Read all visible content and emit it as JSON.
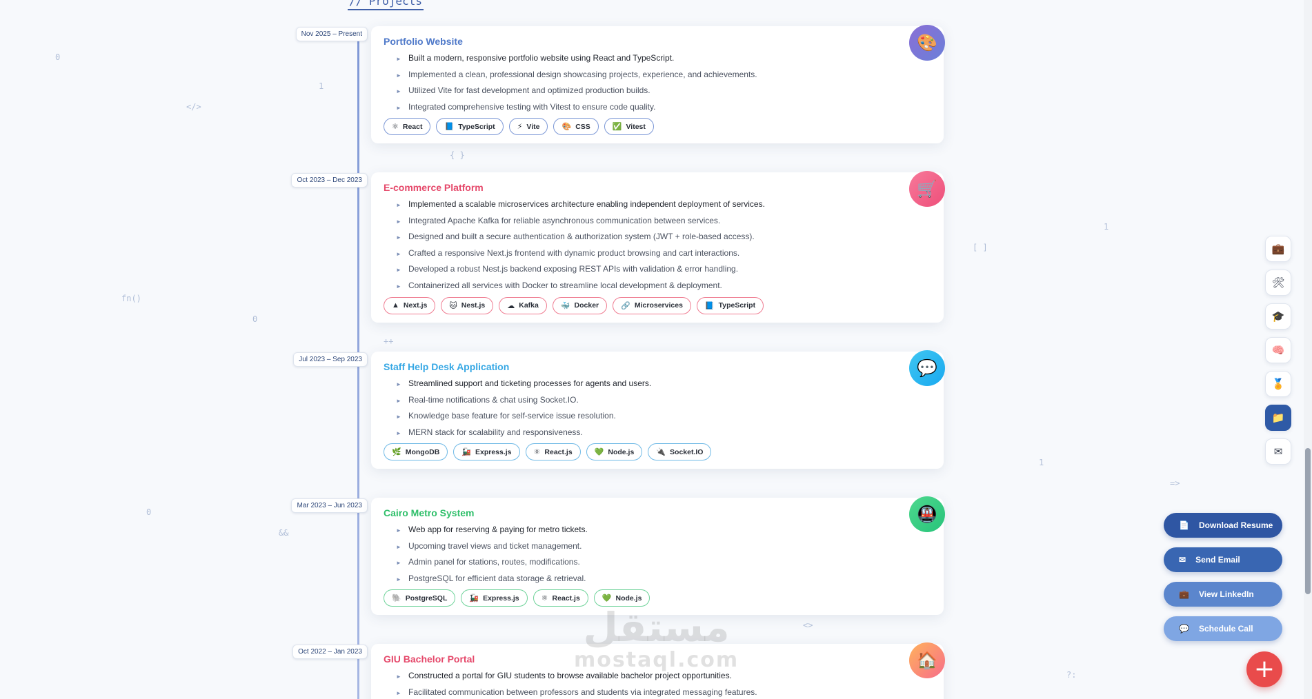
{
  "section": {
    "heading": "// Projects"
  },
  "background_glyphs": [
    "0",
    "1",
    "</>",
    "{ }",
    "fn()",
    "0",
    "++",
    "0",
    "&&",
    "1",
    "[ ]",
    "1",
    "=>",
    "<>",
    "?:"
  ],
  "projects": [
    {
      "date": "Nov 2025 – Present",
      "title": "Portfolio Website",
      "badge_icon": "palette-icon",
      "badge_glyph": "🎨",
      "bullets": [
        "Built a modern, responsive portfolio website using React and TypeScript.",
        "Implemented a clean, professional design showcasing projects, experience, and achievements.",
        "Utilized Vite for fast development and optimized production builds.",
        "Integrated comprehensive testing with Vitest to ensure code quality."
      ],
      "tags": [
        {
          "icon": "⚛",
          "label": "React"
        },
        {
          "icon": "📘",
          "label": "TypeScript"
        },
        {
          "icon": "⚡",
          "label": "Vite"
        },
        {
          "icon": "🎨",
          "label": "CSS"
        },
        {
          "icon": "✅",
          "label": "Vitest"
        }
      ]
    },
    {
      "date": "Oct 2023 – Dec 2023",
      "title": "E-commerce Platform",
      "badge_icon": "cart-icon",
      "badge_glyph": "🛒",
      "bullets": [
        "Implemented a scalable microservices architecture enabling independent deployment of services.",
        "Integrated Apache Kafka for reliable asynchronous communication between services.",
        "Designed and built a secure authentication & authorization system (JWT + role-based access).",
        "Crafted a responsive Next.js frontend with dynamic product browsing and cart interactions.",
        "Developed a robust Nest.js backend exposing REST APIs with validation & error handling.",
        "Containerized all services with Docker to streamline local development & deployment."
      ],
      "tags": [
        {
          "icon": "▲",
          "label": "Next.js"
        },
        {
          "icon": "🐱",
          "label": "Nest.js"
        },
        {
          "icon": "☁",
          "label": "Kafka"
        },
        {
          "icon": "🐳",
          "label": "Docker"
        },
        {
          "icon": "🔗",
          "label": "Microservices"
        },
        {
          "icon": "📘",
          "label": "TypeScript"
        }
      ]
    },
    {
      "date": "Jul 2023 – Sep 2023",
      "title": "Staff Help Desk Application",
      "badge_icon": "chat-bubble-icon",
      "badge_glyph": "💬",
      "bullets": [
        "Streamlined support and ticketing processes for agents and users.",
        "Real-time notifications & chat using Socket.IO.",
        "Knowledge base feature for self-service issue resolution.",
        "MERN stack for scalability and responsiveness."
      ],
      "tags": [
        {
          "icon": "🌿",
          "label": "MongoDB"
        },
        {
          "icon": "🚂",
          "label": "Express.js"
        },
        {
          "icon": "⚛",
          "label": "React.js"
        },
        {
          "icon": "💚",
          "label": "Node.js"
        },
        {
          "icon": "🔌",
          "label": "Socket.IO"
        }
      ]
    },
    {
      "date": "Mar 2023 – Jun 2023",
      "title": "Cairo Metro System",
      "badge_icon": "metro-train-icon",
      "badge_glyph": "🚇",
      "bullets": [
        "Web app for reserving & paying for metro tickets.",
        "Upcoming travel views and ticket management.",
        "Admin panel for stations, routes, modifications.",
        "PostgreSQL for efficient data storage & retrieval."
      ],
      "tags": [
        {
          "icon": "🐘",
          "label": "PostgreSQL"
        },
        {
          "icon": "🚂",
          "label": "Express.js"
        },
        {
          "icon": "⚛",
          "label": "React.js"
        },
        {
          "icon": "💚",
          "label": "Node.js"
        }
      ]
    },
    {
      "date": "Oct 2022 – Jan 2023",
      "title": "GIU Bachelor Portal",
      "badge_icon": "house-icon",
      "badge_glyph": "🏠",
      "bullets": [
        "Constructed a portal for GIU students to browse available bachelor project opportunities.",
        "Facilitated communication between professors and students via integrated messaging features."
      ],
      "tags": []
    }
  ],
  "side_nav": [
    {
      "name": "briefcase-icon",
      "glyph": "💼",
      "active": false
    },
    {
      "name": "tools-icon",
      "glyph": "🛠",
      "active": false
    },
    {
      "name": "graduation-cap-icon",
      "glyph": "🎓",
      "active": false
    },
    {
      "name": "brain-icon",
      "glyph": "🧠",
      "active": false
    },
    {
      "name": "medal-icon",
      "glyph": "🏅",
      "active": false
    },
    {
      "name": "folder-icon",
      "glyph": "📁",
      "active": true
    },
    {
      "name": "envelope-icon",
      "glyph": "✉",
      "active": false
    }
  ],
  "actions": [
    {
      "label": "Download Resume",
      "glyph": "📄",
      "color": "#2f56a3"
    },
    {
      "label": "Send Email",
      "glyph": "✉",
      "color": "#3966b2"
    },
    {
      "label": "View LinkedIn",
      "glyph": "💼",
      "color": "#5b86cd"
    },
    {
      "label": "Schedule Call",
      "glyph": "💬",
      "color": "#7fa6e3"
    }
  ],
  "fab": {
    "glyph": "+"
  },
  "watermark": {
    "arabic": "مستقل",
    "latin": "mostaql.com"
  }
}
